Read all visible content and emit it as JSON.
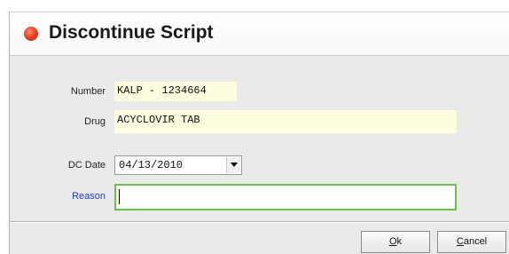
{
  "dialog": {
    "title": "Discontinue Script",
    "title_icon": "red-dot-icon"
  },
  "fields": {
    "number_label": "Number",
    "number_value": "KALP - 1234664",
    "drug_label": "Drug",
    "drug_value": "ACYCLOVIR TAB",
    "dc_date_label": "DC Date",
    "dc_date_value": "04/13/2010",
    "reason_label": "Reason",
    "reason_value": ""
  },
  "buttons": {
    "ok_mnemonic": "O",
    "ok_rest": "k",
    "cancel_mnemonic": "C",
    "cancel_rest": "ancel"
  },
  "colors": {
    "reason_label": "#1a3fc4",
    "reason_focus_border": "#6cc04a",
    "readonly_bg": "#fffde0"
  }
}
